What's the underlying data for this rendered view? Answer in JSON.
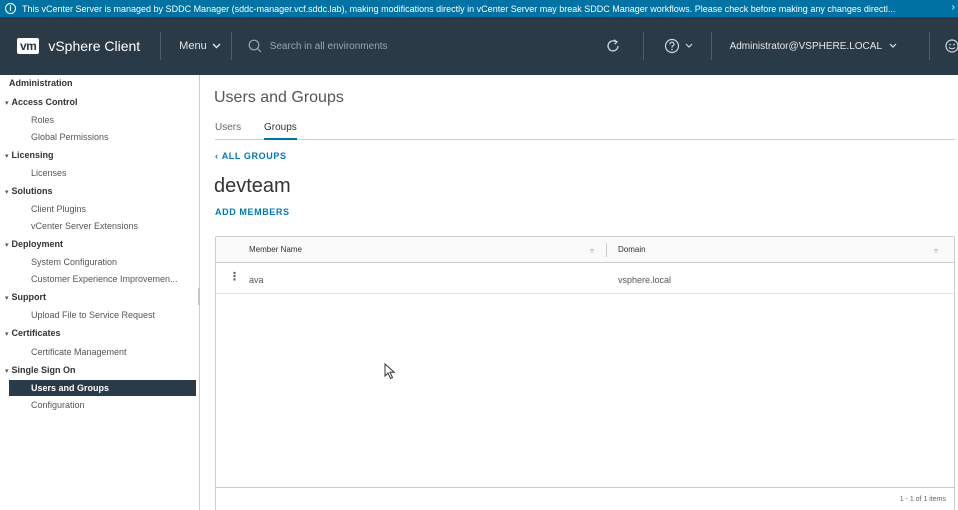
{
  "banner": {
    "message": "This vCenter Server is managed by SDDC Manager (sddc-manager.vcf.sddc.lab), making modifications directly in vCenter Server may break SDDC Manager workflows. Please check before making any changes directl...",
    "close_glyph": "›",
    "color": "#0072a3"
  },
  "header": {
    "logo_text": "vm",
    "app_title": "vSphere Client",
    "menu_label": "Menu",
    "search_placeholder": "Search in all environments",
    "user_label": "Administrator@VSPHERE.LOCAL",
    "background": "#2b3a47",
    "icons": [
      "refresh-icon",
      "help-icon",
      "chevron-down-icon",
      "feedback-smiley-icon"
    ]
  },
  "sidebar": {
    "root_label": "Administration",
    "groups": [
      {
        "label": "Access Control",
        "items": [
          "Roles",
          "Global Permissions"
        ]
      },
      {
        "label": "Licensing",
        "items": [
          "Licenses"
        ]
      },
      {
        "label": "Solutions",
        "items": [
          "Client Plugins",
          "vCenter Server Extensions"
        ]
      },
      {
        "label": "Deployment",
        "items": [
          "System Configuration",
          "Customer Experience Improvemen..."
        ]
      },
      {
        "label": "Support",
        "items": [
          "Upload File to Service Request"
        ]
      },
      {
        "label": "Certificates",
        "items": [
          "Certificate Management"
        ]
      },
      {
        "label": "Single Sign On",
        "items": [
          "Users and Groups",
          "Configuration"
        ]
      }
    ],
    "active_item": "Users and Groups"
  },
  "main": {
    "page_title": "Users and Groups",
    "tabs": [
      {
        "label": "Users",
        "active": false
      },
      {
        "label": "Groups",
        "active": true
      }
    ],
    "back_link": "ALL GROUPS",
    "group_name": "devteam",
    "add_members_label": "ADD MEMBERS",
    "grid": {
      "columns": [
        "Member Name",
        "Domain"
      ],
      "rows": [
        {
          "member": "ava",
          "domain": "vsphere.local"
        }
      ],
      "footer": "1 - 1 of 1 items"
    }
  }
}
